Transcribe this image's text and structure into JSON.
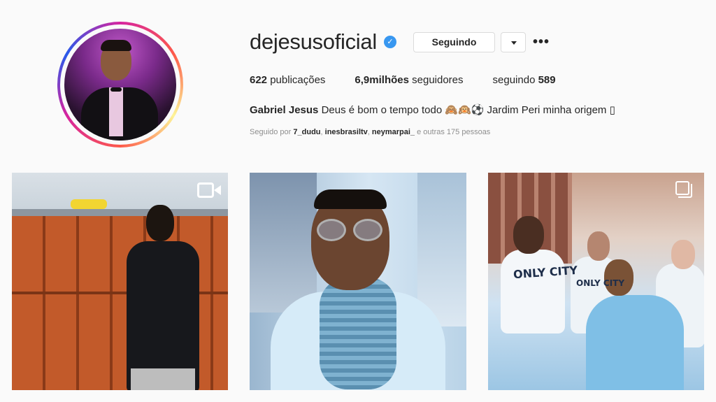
{
  "profile": {
    "username": "dejesusoficial",
    "verified_icon": "verified-badge-icon",
    "follow_button_label": "Seguindo",
    "dropdown_icon": "chevron-down-icon",
    "more_label": "•••",
    "stats": {
      "posts_count": "622",
      "posts_label": "publicações",
      "followers_count": "6,9milhões",
      "followers_label": "seguidores",
      "following_label": "seguindo",
      "following_count": "589"
    },
    "bio": {
      "full_name": "Gabriel Jesus",
      "text": "Deus é bom o tempo todo 🙈🙉⚽ Jardim Peri minha origem ▯"
    },
    "followed_by": {
      "prefix": "Seguido por",
      "users": [
        "7_dudu",
        "inesbrasiltv",
        "neymarpai_"
      ],
      "suffix": "e outras 175 pessoas"
    }
  },
  "posts": [
    {
      "type": "video",
      "icon": "video-camera-icon"
    },
    {
      "type": "photo"
    },
    {
      "type": "carousel",
      "icon": "multiple-photos-icon",
      "shirt_text": "ONLY CITY"
    }
  ],
  "colors": {
    "accent_blue": "#3897f0",
    "text": "#262626",
    "muted": "#8e8e8e",
    "border": "#dbdbdb"
  }
}
